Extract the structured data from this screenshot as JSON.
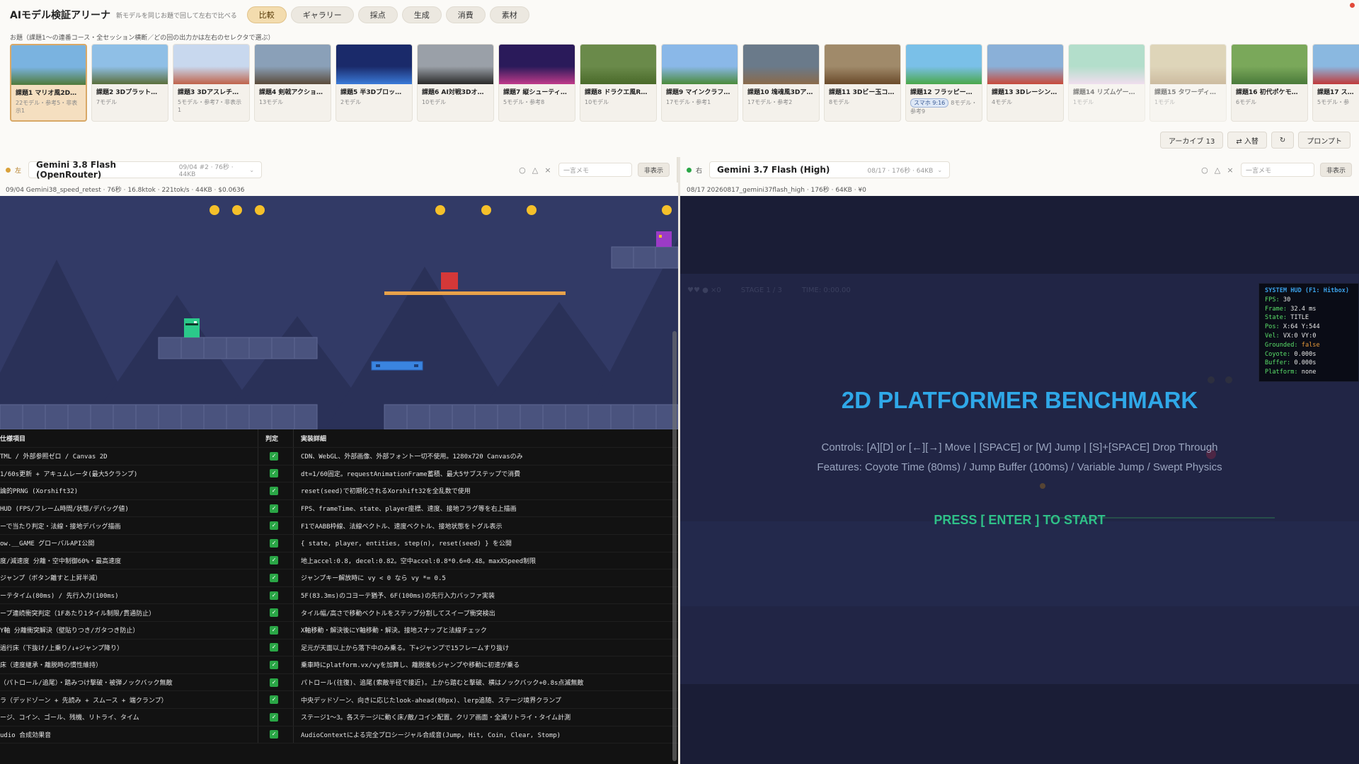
{
  "header": {
    "title": "AIモデル検証アリーナ",
    "subtitle": "新モデルを同じお題で回して左右で比べる",
    "tabs": [
      "比較",
      "ギャラリー",
      "採点",
      "生成",
      "消費",
      "素材"
    ]
  },
  "topics_label": "お題（課題1〜の連番コース・全セッション横断／どの回の出力かは左右のセレクタで選ぶ）",
  "topics": [
    {
      "title": "課題1 マリオ風2D…",
      "meta": "22モデル・参考5・非表示1"
    },
    {
      "title": "課題2 3Dプラット…",
      "meta": "7モデル"
    },
    {
      "title": "課題3 3Dアスレチ…",
      "meta": "5モデル・参考7・非表示1"
    },
    {
      "title": "課題4 剣戟アクショ…",
      "meta": "13モデル"
    },
    {
      "title": "課題5 半3Dブロッ…",
      "meta": "2モデル"
    },
    {
      "title": "課題6 AI対戦3Dオ…",
      "meta": "10モデル"
    },
    {
      "title": "課題7 縦シューティ…",
      "meta": "5モデル・参考8"
    },
    {
      "title": "課題8 ドラクエ風R…",
      "meta": "10モデル"
    },
    {
      "title": "課題9 マインクラフ…",
      "meta": "17モデル・参考1"
    },
    {
      "title": "課題10 塊魂風3Dア…",
      "meta": "17モデル・参考2"
    },
    {
      "title": "課題11 3Dビー玉コ…",
      "meta": "8モデル"
    },
    {
      "title": "課題12 フラッピー…",
      "meta": "8モデル・参考9",
      "badge": "スマホ 9:16"
    },
    {
      "title": "課題13 3Dレーシン…",
      "meta": "4モデル"
    },
    {
      "title": "課題14 リズムゲー…",
      "meta": "1モデル"
    },
    {
      "title": "課題15 タワーディ…",
      "meta": "1モデル"
    },
    {
      "title": "課題16 初代ポケモ…",
      "meta": "6モデル"
    },
    {
      "title": "課題17 ス…",
      "meta": "5モデル・参"
    }
  ],
  "toolbar": {
    "archive": "アーカイブ 13",
    "swap": "⇄ 入替",
    "refresh": "↻",
    "prompt": "プロンプト"
  },
  "left": {
    "side": "左",
    "model": "Gemini 3.8 Flash (OpenRouter)",
    "meta": "09/04 #2 · 76秒 · 44KB",
    "memo_placeholder": "一言メモ",
    "hide": "非表示",
    "subinfo": "09/04 Gemini38_speed_retest · 76秒 · 16.8ktok · 221tok/s · 44KB · $0.0636",
    "dot_color": "#d9a13a"
  },
  "right": {
    "side": "右",
    "model": "Gemini 3.7 Flash (High)",
    "meta": "08/17 · 176秒 · 64KB",
    "memo_placeholder": "一言メモ",
    "hide": "非表示",
    "subinfo": "08/17 20260817_gemini37flash_high · 176秒 · 64KB · ¥0",
    "dot_color": "#2aa646"
  },
  "spec_table": {
    "headers": [
      "仕様項目",
      "判定",
      "実装詳細"
    ],
    "rows": [
      [
        "TML / 外部参照ゼロ / Canvas 2D",
        "CDN、WebGL、外部画像、外部フォント一切不使用。1280x720 Canvasのみ"
      ],
      [
        "1/60s更新 + アキュムレータ(最大5クランプ)",
        "dt=1/60固定。requestAnimationFrame蓄積、最大5サブステップで消費"
      ],
      [
        "論的PRNG (Xorshift32)",
        "reset(seed)で初期化されるXorshift32を全乱数で使用"
      ],
      [
        "HUD (FPS/フレーム時間/状態/デバッグ値)",
        "FPS、frameTime、state、player座標、速度、接地フラグ等を右上描画"
      ],
      [
        "ーで当たり判定・法線・接地デバッグ描画",
        "F1でAABB枠線、法線ベクトル、速度ベクトル、接地状態をトグル表示"
      ],
      [
        "ow.__GAME グローバルAPI公開",
        "{ state, player, entities, step(n), reset(seed) } を公開"
      ],
      [
        "度/減速度 分離・空中制御60%・最高速度",
        "地上accel:0.8, decel:0.82。空中accel:0.8*0.6=0.48。maxXSpeed制限"
      ],
      [
        "ジャンプ（ボタン離すと上昇半減）",
        "ジャンプキー解放時に vy < 0 なら vy *= 0.5"
      ],
      [
        "ーテタイム(80ms) / 先行入力(100ms)",
        "5F(83.3ms)のコヨーテ猶予、6F(100ms)の先行入力バッファ実装"
      ],
      [
        "ープ連続衝突判定（1Fあたり1タイル制限/貫通防止）",
        "タイル幅/高さで移動ベクトルをステップ分割してスイープ衝突検出"
      ],
      [
        "Y軸 分離衝突解決（壁貼りつき/ガタつき防止）",
        "X軸移動・解決後にY軸移動・解決。接地スナップと法線チェック"
      ],
      [
        "過行床（下抜け/上乗り/↓+ジャンプ降り）",
        "足元が天面以上から落下中のみ乗る。下+ジャンプで15フレームすり抜け"
      ],
      [
        "床（速度継承・離脱時の慣性維持）",
        "乗車時にplatform.vx/vyを加算し、離脱後もジャンプや移動に初速が乗る"
      ],
      [
        "（パトロール/追尾）・踏みつけ撃破・被弾ノックバック無敵",
        "パトロール(往復)、追尾(索敵半径で接近)。上から踏むと撃破、横はノックバック+0.8s点滅無敵"
      ],
      [
        "ラ（デッドゾーン + 先読み + スムース + 端クランプ）",
        "中央デッドゾーン、向きに応じたlook-ahead(80px)、lerp追随、ステージ境界クランプ"
      ],
      [
        "ージ、コイン、ゴール、残機、リトライ、タイム",
        "ステージ1〜3。各ステージに動く床/敵/コイン配置。クリア画面・全滅リトライ・タイム計測"
      ],
      [
        "udio 合成効果音",
        "AudioContextによる完全プロシージャル合成音(Jump, Hit, Coin, Clear, Stomp)"
      ]
    ]
  },
  "right_game": {
    "title": "2D PLATFORMER BENCHMARK",
    "controls": "Controls: [A][D] or [←][→] Move | [SPACE] or [W] Jump | [S]+[SPACE] Drop Through",
    "features": "Features: Coyote Time (80ms) / Jump Buffer (100ms) / Variable Jump / Swept Physics",
    "start": "PRESS [ ENTER ] TO START",
    "top_hud": [
      "♥♥  ● ×0",
      "STAGE 1 / 3",
      "TIME: 0:00.00"
    ],
    "hud": {
      "title": "SYSTEM HUD (F1: Hitbox)",
      "lines": [
        {
          "k": "FPS:",
          "v": "30"
        },
        {
          "k": "Frame:",
          "v": "32.4 ms"
        },
        {
          "k": "State:",
          "v": "TITLE"
        },
        {
          "k": "Pos:",
          "v": "X:64 Y:544"
        },
        {
          "k": "Vel:",
          "v": "VX:0 VY:0"
        },
        {
          "k": "Grounded:",
          "v": "false"
        },
        {
          "k": "Coyote:",
          "v": "0.000s"
        },
        {
          "k": "Buffer:",
          "v": "0.000s"
        },
        {
          "k": "Platform:",
          "v": "none"
        }
      ]
    }
  }
}
